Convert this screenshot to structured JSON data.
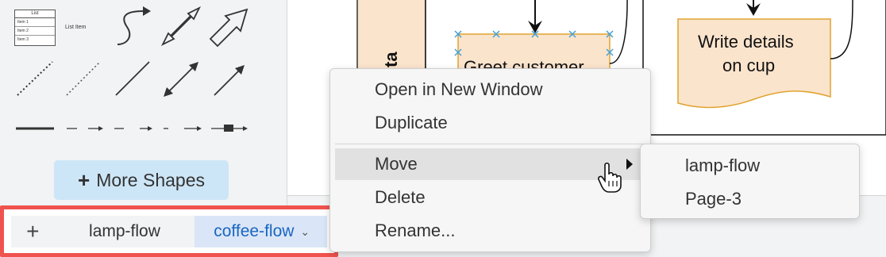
{
  "shape_panel": {
    "list_shape": {
      "header": "List",
      "items": [
        "Item 1",
        "Item 2",
        "Item 3"
      ]
    },
    "list_item_label": "List Item",
    "more_shapes_button": {
      "icon": "plus-icon",
      "label": "More Shapes"
    }
  },
  "diagram": {
    "barista_lane_label": "Barista",
    "greet_customer_text": "Greet customer",
    "write_details_text": "Write details on cup",
    "colors": {
      "node_fill": "#fbe4cc",
      "node_stroke": "#e0a330",
      "lane_fill": "#fbe4cc"
    }
  },
  "page_tabs": {
    "add_icon": "+",
    "tabs": [
      {
        "label": "lamp-flow",
        "selected": false
      },
      {
        "label": "coffee-flow",
        "selected": true
      }
    ],
    "chevron_icon": "⌄"
  },
  "context_menu": {
    "items": [
      {
        "label": "Open in New Window"
      },
      {
        "label": "Duplicate"
      },
      {
        "label": "Move",
        "has_submenu": true,
        "highlighted": true
      },
      {
        "label": "Delete"
      },
      {
        "label": "Rename..."
      }
    ]
  },
  "move_submenu": {
    "items": [
      {
        "label": "lamp-flow"
      },
      {
        "label": "Page-3"
      }
    ]
  },
  "colors": {
    "highlight_border": "#f0534e",
    "selected_tab_text": "#1a65c2",
    "selected_tab_bg": "#dae6f7",
    "more_shapes_bg": "#cde6f7"
  }
}
